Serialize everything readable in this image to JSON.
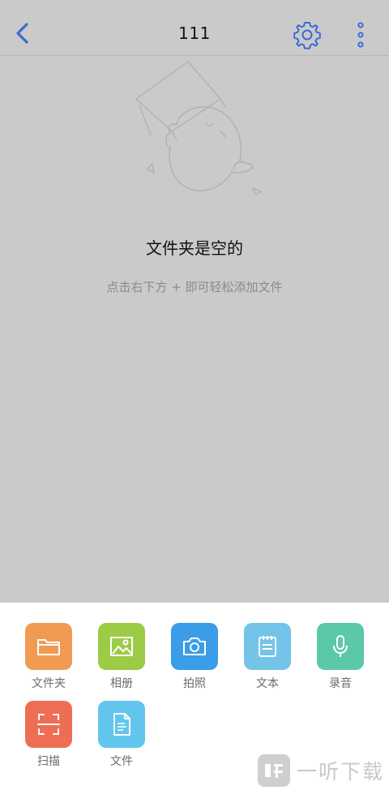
{
  "header": {
    "title": "111",
    "back_icon": "chevron-left-icon",
    "settings_icon": "gear-icon",
    "more_icon": "more-vertical-icon"
  },
  "empty_state": {
    "title": "文件夹是空的",
    "hint": "点击右下方 + 即可轻松添加文件"
  },
  "actions": [
    {
      "label": "文件夹",
      "icon": "folder-icon",
      "color": "#f19a52"
    },
    {
      "label": "相册",
      "icon": "image-icon",
      "color": "#9ccb46"
    },
    {
      "label": "拍照",
      "icon": "camera-icon",
      "color": "#3b9ce8"
    },
    {
      "label": "文本",
      "icon": "notepad-icon",
      "color": "#74c4ea"
    },
    {
      "label": "录音",
      "icon": "microphone-icon",
      "color": "#5bc9a8"
    },
    {
      "label": "扫描",
      "icon": "scan-icon",
      "color": "#ee6e55"
    },
    {
      "label": "文件",
      "icon": "file-icon",
      "color": "#62c5ee"
    }
  ],
  "colors": {
    "accent": "#3a6bd5",
    "page_background": "#cacaca",
    "sheet_background": "#ffffff"
  },
  "watermark": {
    "text": "一听下载"
  }
}
